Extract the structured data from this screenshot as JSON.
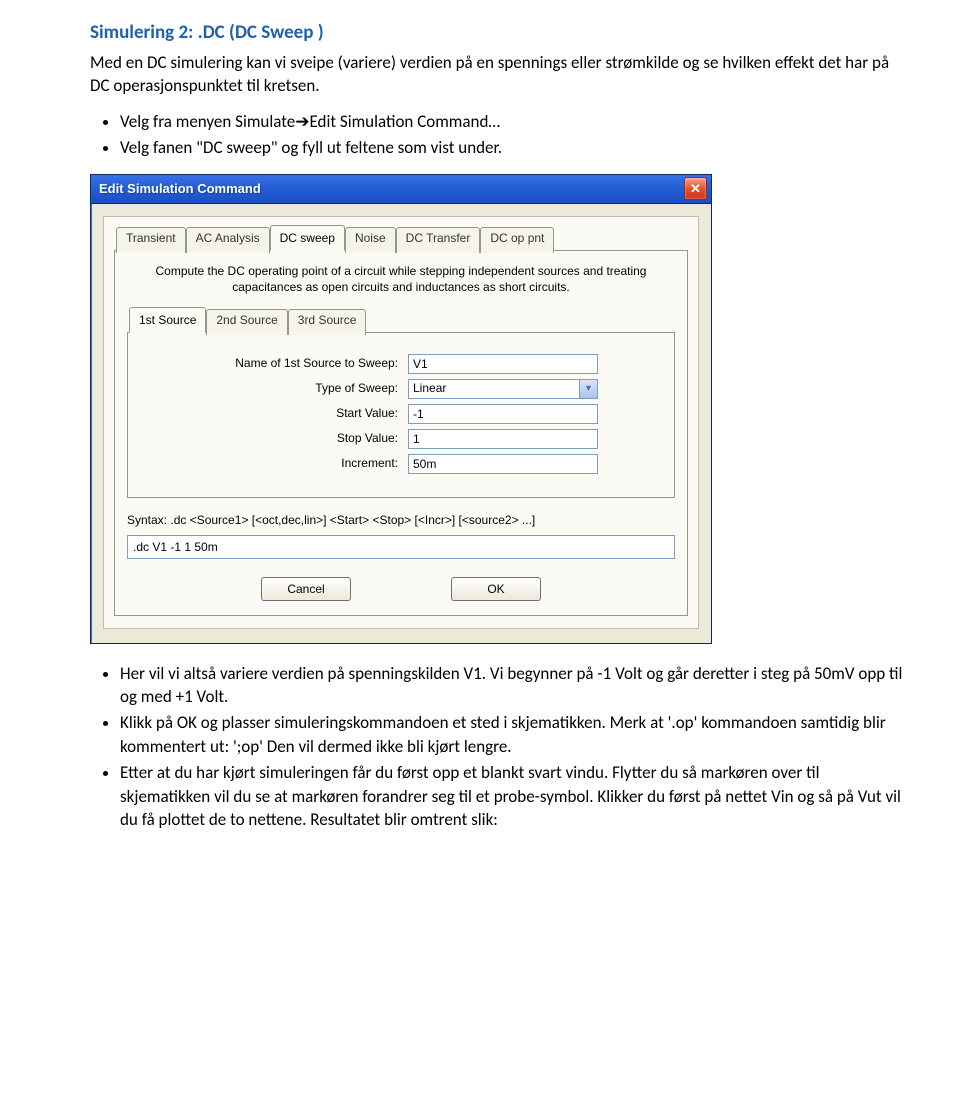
{
  "doc": {
    "title": "Simulering 2: .DC (DC Sweep )",
    "intro": "Med en DC simulering kan vi sveipe (variere) verdien på en spennings eller strømkilde og se hvilken effekt det har på DC operasjonspunktet til kretsen.",
    "pre_bullets": [
      "Velg fra menyen Simulate➔Edit Simulation Command…",
      "Velg fanen \"DC sweep\" og fyll ut feltene som vist under."
    ],
    "post_bullets": [
      "Her vil vi altså variere verdien på spenningskilden V1. Vi begynner på -1 Volt og går deretter i steg på 50mV opp til og med +1 Volt.",
      "Klikk på OK og plasser simuleringskommandoen et sted i skjematikken. Merk at '.op' kommandoen samtidig blir kommentert ut: ';op' Den vil dermed ikke bli kjørt lengre.",
      "Etter at du har kjørt simuleringen får du først opp et blankt svart vindu. Flytter du så markøren over til skjematikken vil du se at markøren forandrer seg til et probe-symbol. Klikker du først på nettet Vin og så på Vut vil du få plottet de to nettene. Resultatet blir omtrent slik:"
    ]
  },
  "dialog": {
    "title": "Edit Simulation Command",
    "close_glyph": "✕",
    "top_tabs": [
      "Transient",
      "AC Analysis",
      "DC sweep",
      "Noise",
      "DC Transfer",
      "DC op pnt"
    ],
    "top_active": 2,
    "desc": "Compute the DC operating point of a circuit while stepping independent sources and treating capacitances as open circuits and inductances as short circuits.",
    "src_tabs": [
      "1st Source",
      "2nd Source",
      "3rd Source"
    ],
    "src_active": 0,
    "fields": {
      "name_label": "Name of 1st Source to Sweep:",
      "name_value": "V1",
      "type_label": "Type of Sweep:",
      "type_value": "Linear",
      "start_label": "Start Value:",
      "start_value": "-1",
      "stop_label": "Stop Value:",
      "stop_value": "1",
      "incr_label": "Increment:",
      "incr_value": "50m"
    },
    "syntax_label": "Syntax: .dc <Source1> [<oct,dec,lin>] <Start> <Stop> [<Incr>] [<source2> ...]",
    "cmd": ".dc V1 -1 1 50m",
    "cancel": "Cancel",
    "ok": "OK"
  }
}
